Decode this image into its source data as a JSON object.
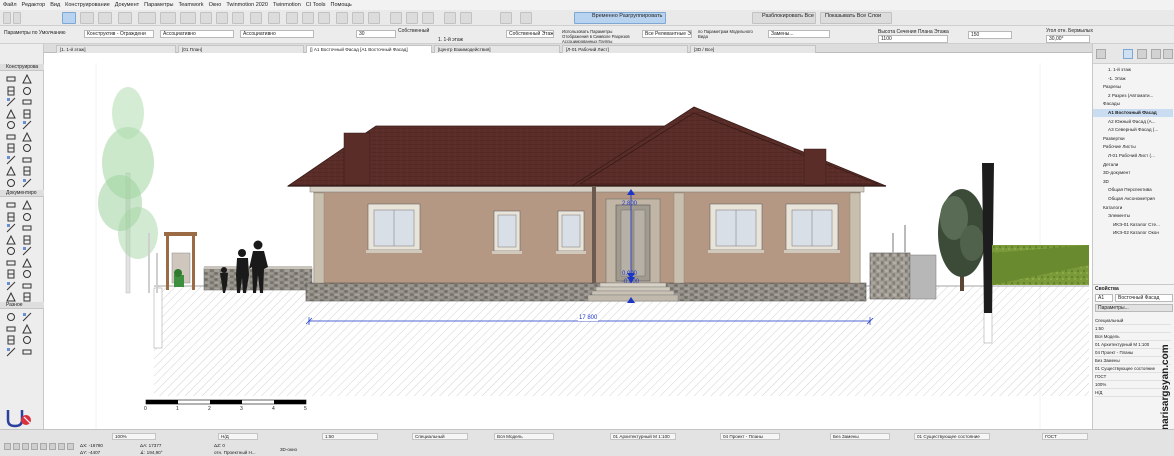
{
  "menu": [
    "Файл",
    "Редактор",
    "Вид",
    "Конструирование",
    "Документ",
    "Параметры",
    "Teamwork",
    "Окно",
    "Twinmotion 2020",
    "Twinmotion",
    "CI Tools",
    "Помощь"
  ],
  "toolbar": {
    "temp_group_label": "Временно Разгруппировать",
    "lock_all_label": "Разблокировать Все",
    "show_all_layers_label": "Показывать Все Слои"
  },
  "infobox": {
    "default_params": "Параметры по Умолчанию",
    "construction_value": "Конструктив - Ограждени",
    "associative_1": "Ассоциативно",
    "associative_2": "Ассоциативно",
    "offset_value": "30",
    "own_label": "Собственный",
    "own_floor": "Собственный Этаж",
    "floor_1": "1. 1-й этаж",
    "use_params_label": "Использовать Параметры Отображения в Символе Разрезов Ассоциированных Группы",
    "all_relevant": "Все Релевантные Эл...",
    "model_view_params": "по Параметрам Модельного Вида",
    "replacements": "Замены...",
    "section_height_label": "Высота Сечения Плана Этажа",
    "section_height_value": "1100",
    "value_150": "150",
    "beam_angle_label": "Угол отн. Бермылых",
    "beam_angle_value": "30,00°"
  },
  "tabs": [
    "[1. 1-й этаж]",
    "[01 План]",
    "[] А1 Восточный Фасад [А1 Восточный Фасад]",
    "[Центр Взаимодействия]",
    "[Л-01 Рабочий Лист]",
    "[3D / Все]"
  ],
  "toolbox": {
    "construction_header": "Конструирова",
    "document_header": "Документиро",
    "misc_header": "Разное"
  },
  "drawing": {
    "elevation_top": "2.800",
    "elevation_mid": "0.000",
    "elevation_bottom": "-0.600",
    "dimension": "17 800",
    "scale_ticks": [
      "0",
      "1",
      "2",
      "3",
      "4",
      "5"
    ]
  },
  "navigator": {
    "items": [
      {
        "label": "1. 1-й этаж",
        "indent": 3
      },
      {
        "label": "-1. Этаж",
        "indent": 3
      },
      {
        "label": "Разрезы",
        "indent": 2
      },
      {
        "label": "2 Разрез (Автомати...",
        "indent": 3
      },
      {
        "label": "Фасады",
        "indent": 2
      },
      {
        "label": "А1 Восточный Фасад",
        "indent": 3,
        "selected": true
      },
      {
        "label": "А2 Южный Фасад (А...",
        "indent": 3
      },
      {
        "label": "А3 Северный Фасад (...",
        "indent": 3
      },
      {
        "label": "Развертки",
        "indent": 2
      },
      {
        "label": "Рабочие Листы",
        "indent": 2
      },
      {
        "label": "Л-01 Рабочий Лист (...",
        "indent": 3
      },
      {
        "label": "Детали",
        "indent": 2
      },
      {
        "label": "3D-документ",
        "indent": 2
      },
      {
        "label": "3D",
        "indent": 2
      },
      {
        "label": "Общая Перспектива",
        "indent": 3
      },
      {
        "label": "Общая Аксонометрия",
        "indent": 3
      },
      {
        "label": "Каталоги",
        "indent": 2
      },
      {
        "label": "Элементы",
        "indent": 3
      },
      {
        "label": "ИКЭ-01 Каталог Сте...",
        "indent": 4
      },
      {
        "label": "ИКЭ-02 Каталог Окон",
        "indent": 4
      }
    ]
  },
  "properties": {
    "title": "Свойства",
    "id": "А1",
    "name": "Восточный Фасад",
    "params_button": "Параметры...",
    "rows": [
      "Специальный",
      "1:50",
      "Вся Модель",
      "01 Архитектурный М 1:100",
      "04 Проект - Планы",
      "Без Замены",
      "01 Существующее состояние",
      "ГОСТ",
      "100%",
      "Н/Д"
    ]
  },
  "statusbar": {
    "zoom": "100%",
    "nd1": "Н/Д",
    "scale": "1:50",
    "view": "Специальный",
    "model": "Вся Модель",
    "layer_combo": "01 Архитектурный М 1:100",
    "pen_set": "04 Проект - Планы",
    "overrides": "Без Замены",
    "renovation": "01 Существующее состояние",
    "dim_std": "ГОСТ",
    "coord_x": "ΔX: -16780",
    "coord_y": "ΔY: -4407",
    "coord_a": "ΔA: 17377",
    "coord_b": "∡: 194,90°",
    "coord_z": "ΔZ: 0",
    "proj_label": "отн. Проектный Н...",
    "view3d": "3D-окно"
  },
  "watermark": "narisargsyan.com",
  "colors": {
    "roof": "#5a2d28",
    "wall": "#b59884",
    "stone": "#8d8a83",
    "accent_blue": "#1a35c7",
    "tab_active": "#ffffff",
    "selection": "#c9dcf1"
  }
}
